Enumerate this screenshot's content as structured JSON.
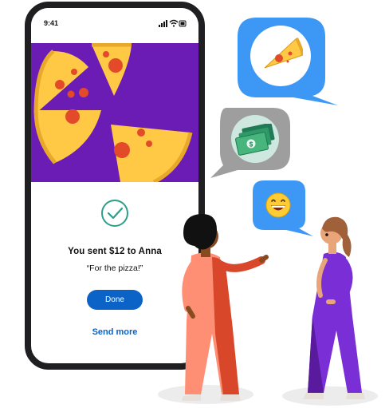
{
  "status_bar": {
    "time": "9:41"
  },
  "confirmation": {
    "message": "You sent $12 to Anna",
    "note": "“For the pizza!”",
    "done_label": "Done",
    "send_more_label": "Send more"
  },
  "bubbles": [
    {
      "icon": "pizza-slice-icon"
    },
    {
      "icon": "cash-icon"
    },
    {
      "icon": "grinning-face-icon"
    }
  ],
  "colors": {
    "accent_blue": "#0b62c7",
    "bubble_blue": "#3d97f5",
    "bubble_gray": "#9e9e9e",
    "hero_purple": "#6a1cb5",
    "pizza_yellow": "#ffc845",
    "pepperoni_red": "#e24a2a",
    "check_green": "#2e9e8a"
  }
}
